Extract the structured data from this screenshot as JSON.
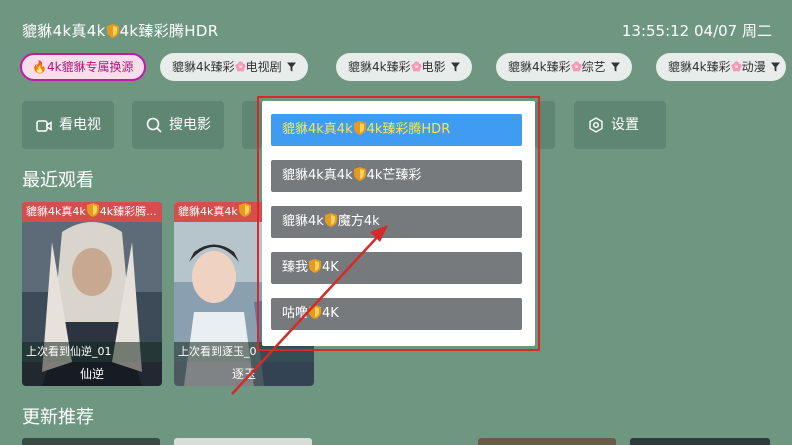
{
  "header": {
    "title_prefix": "貔貅4k真4k",
    "title_suffix": "4k臻彩腾HDR",
    "clock": "13:55:12 04/07 周二"
  },
  "sources": [
    {
      "label": "🔥4k貔貅专属换源",
      "active": true
    },
    {
      "label_a": "貔貅4k臻彩",
      "label_b": "电视剧"
    },
    {
      "label_a": "貔貅4k臻彩",
      "label_b": "电影"
    },
    {
      "label_a": "貔貅4k臻彩",
      "label_b": "综艺"
    },
    {
      "label_a": "貔貅4k臻彩",
      "label_b": "动漫"
    }
  ],
  "nav": {
    "tv": "看电视",
    "search": "搜电影",
    "settings": "设置"
  },
  "recent": {
    "title": "最近观看",
    "cards": [
      {
        "badge_a": "貔貅4k真4k",
        "badge_b": "4k臻彩腾...",
        "progress": "上次看到仙逆_01",
        "name": "仙逆"
      },
      {
        "badge_a": "貔貅4k真4k",
        "badge_b": "",
        "progress": "上次看到逐玉_0",
        "name": "逐玉"
      }
    ]
  },
  "updates": {
    "title": "更新推荐"
  },
  "popup": {
    "options": [
      {
        "a": "貔貅4k真4k",
        "b": "4k臻彩腾HDR",
        "selected": true
      },
      {
        "a": "貔貅4k真4k",
        "b": "4k芒臻彩",
        "selected": false
      },
      {
        "a": "貔貅4k",
        "b": "魔方4k",
        "selected": false
      },
      {
        "a": "臻我",
        "b": "4K",
        "selected": false
      },
      {
        "a": "咕噜",
        "b": "4K",
        "selected": false
      }
    ]
  },
  "colors": {
    "background": "#6f9680",
    "selected_option": "#3f9cf1",
    "highlight_border": "#d42a2a"
  }
}
